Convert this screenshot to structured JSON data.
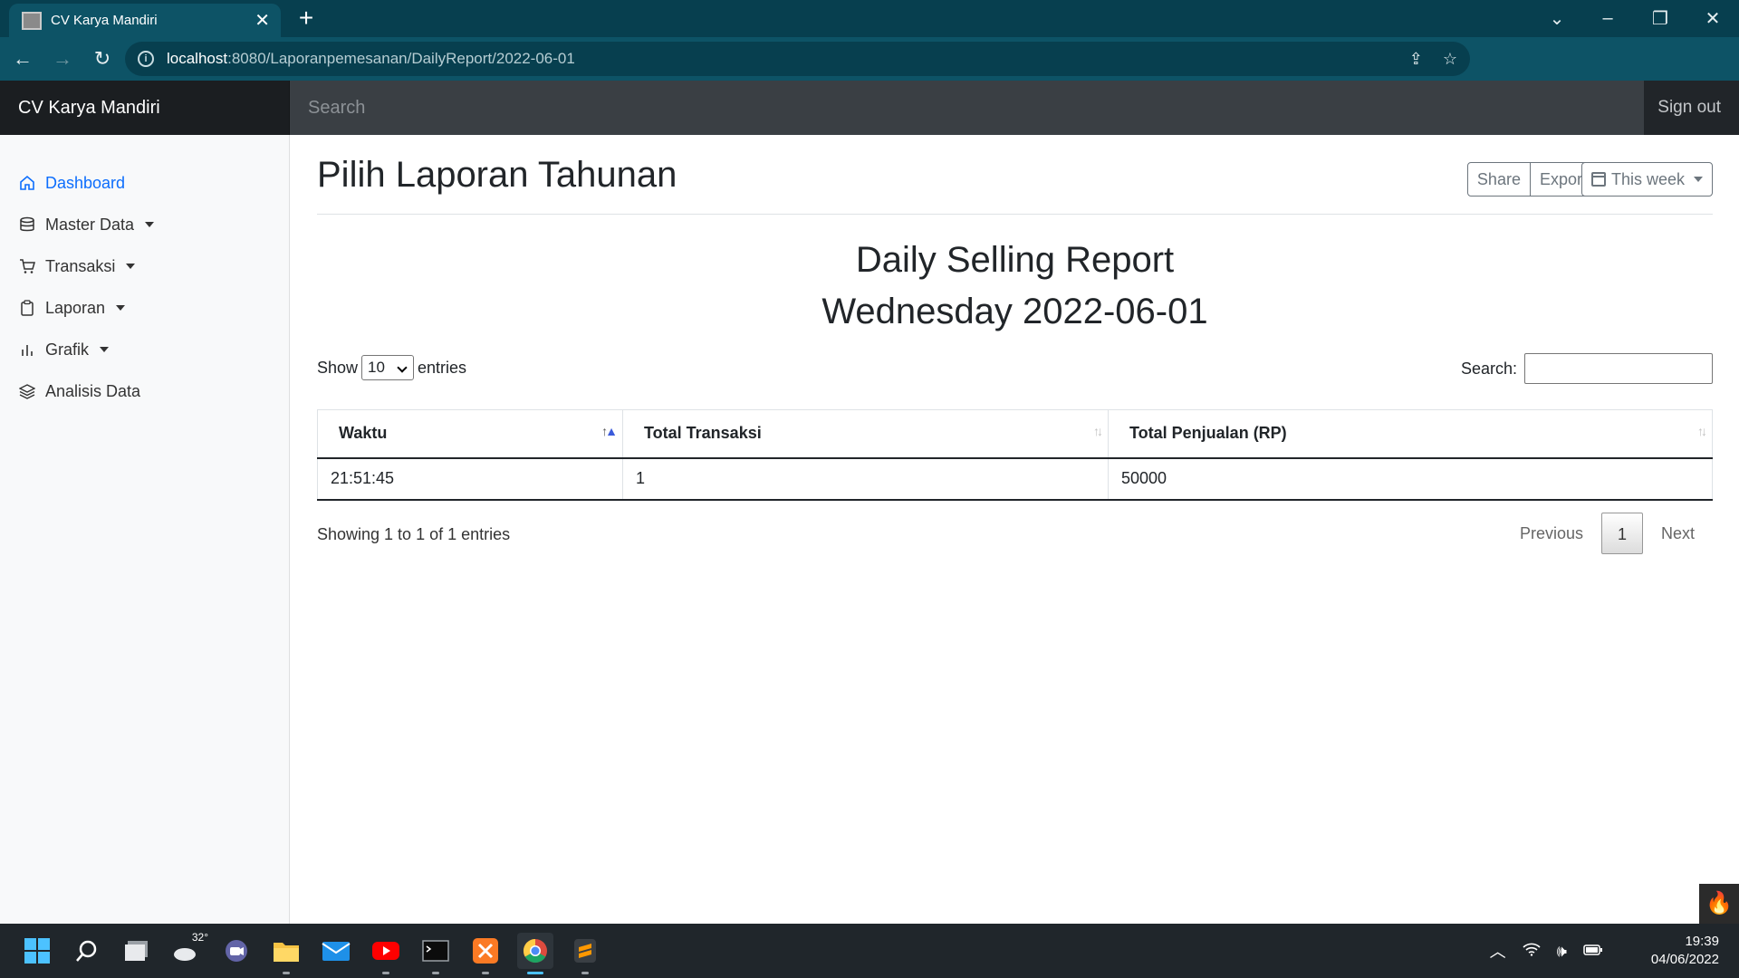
{
  "browser": {
    "tab_title": "CV Karya Mandiri",
    "url_host": "localhost",
    "url_path": ":8080/Laporanpemesanan/DailyReport/2022-06-01"
  },
  "navbar": {
    "brand": "CV Karya Mandiri",
    "search_placeholder": "Search",
    "signout": "Sign out"
  },
  "sidebar": {
    "items": [
      {
        "label": "Dashboard",
        "icon": "home-icon",
        "active": true
      },
      {
        "label": "Master Data",
        "icon": "database-icon"
      },
      {
        "label": "Transaksi",
        "icon": "cart-icon"
      },
      {
        "label": "Laporan",
        "icon": "clipboard-icon"
      },
      {
        "label": "Grafik",
        "icon": "bar-chart-icon"
      },
      {
        "label": "Analisis Data",
        "icon": "layers-icon"
      }
    ]
  },
  "main": {
    "page_title": "Pilih Laporan Tahunan",
    "share_label": "Share",
    "export_label": "Export",
    "range_label": "This week",
    "report_title": "Daily Selling Report",
    "report_date": "Wednesday 2022-06-01"
  },
  "datatable": {
    "show_label": "Show",
    "entries_label": "entries",
    "length_value": "10",
    "search_label": "Search:",
    "columns": [
      "Waktu",
      "Total Transaksi",
      "Total Penjualan (RP)"
    ],
    "rows": [
      [
        "21:51:45",
        "1",
        "50000"
      ]
    ],
    "info": "Showing 1 to 1 of 1 entries",
    "previous": "Previous",
    "page": "1",
    "next": "Next"
  },
  "taskbar": {
    "weather_temp": "32°",
    "time": "19:39",
    "date": "04/06/2022"
  },
  "colors": {
    "browser_frame": "#073f4f",
    "navbar": "#212529",
    "accent": "#0d6efd"
  }
}
